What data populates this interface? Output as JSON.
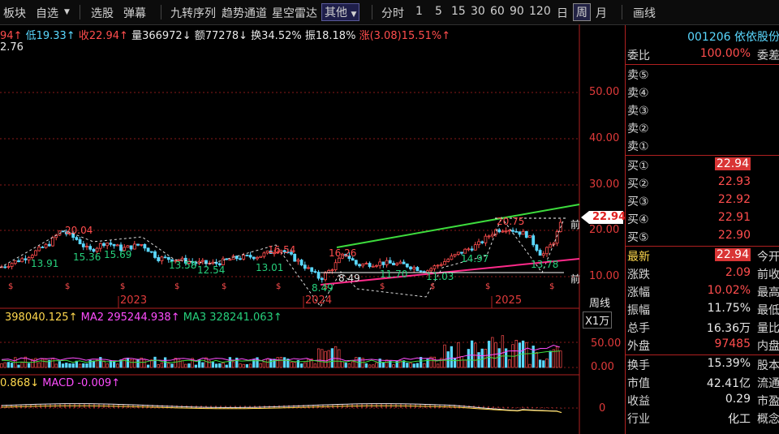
{
  "toolbar": {
    "items": [
      "板块",
      "自选",
      "选股",
      "弹幕",
      "九转序列",
      "趋势通道",
      "星空雷达",
      "其他",
      "分时",
      "1",
      "5",
      "15",
      "30",
      "60",
      "90",
      "120",
      "日",
      "周",
      "月",
      "画线"
    ]
  },
  "info": {
    "open_frag": "94↑",
    "low": "低19.33↑",
    "close": "收22.94↑",
    "volume": "量366972↓",
    "amount": "额77278↓",
    "turnover": "换34.52%",
    "amplitude": "振18.18%",
    "change": "涨(3.08)15.51%↑",
    "second": "2.76"
  },
  "price_axis": [
    "50.00",
    "40.00",
    "30.00",
    "20.00",
    "10.00"
  ],
  "current_price": "22.94",
  "current_tag": "前",
  "bottom_tag": "前",
  "years": [
    "2023",
    "2024",
    "2025"
  ],
  "period_label": "周线",
  "price_labels": {
    "high_left": "20.04",
    "l1": "13.91",
    "l2": "15.36",
    "l3": "15.69",
    "l4": "13.58",
    "l5": "12.54",
    "l6": "13.01",
    "l7": "16.54",
    "l8": "8.49",
    "l9": "8.49",
    "l10": "11.70",
    "l11": "11.03",
    "l12": "16.26",
    "l13": "14.97",
    "l14": "13.78",
    "l15": "20.75"
  },
  "volume_line": {
    "v1": "398040.125↑",
    "ma2": "MA2 295244.938↑",
    "ma3": "MA3 328241.063↑"
  },
  "volume_axis": [
    "50.00",
    "0.00"
  ],
  "volume_unit": "X1万",
  "macd_line": {
    "v1": "0.868↓",
    "macd": "MACD -0.009↑"
  },
  "macd_axis": "0",
  "panel": {
    "code_name": "001206 依依股份",
    "weibi": {
      "label": "委比",
      "value": "100.00%",
      "extra": "委差"
    },
    "sell": [
      "卖⑤",
      "卖④",
      "卖③",
      "卖②",
      "卖①"
    ],
    "buy": [
      {
        "label": "买①",
        "value": "22.94"
      },
      {
        "label": "买②",
        "value": "22.93"
      },
      {
        "label": "买③",
        "value": "22.92"
      },
      {
        "label": "买④",
        "value": "22.91"
      },
      {
        "label": "买⑤",
        "value": "22.90"
      }
    ],
    "stats": [
      {
        "label": "最新",
        "value": "22.94",
        "extra": "今开"
      },
      {
        "label": "涨跌",
        "value": "2.09",
        "extra": "前收"
      },
      {
        "label": "涨幅",
        "value": "10.02%",
        "extra": "最高"
      },
      {
        "label": "振幅",
        "value": "11.75%",
        "extra": "最低"
      },
      {
        "label": "总手",
        "value": "16.36万",
        "extra": "量比"
      },
      {
        "label": "外盘",
        "value": "97485",
        "extra": "内盘"
      }
    ],
    "stats2": [
      {
        "label": "换手",
        "value": "15.39%",
        "extra": "股本"
      },
      {
        "label": "市值",
        "value": "42.41亿",
        "extra": "流通"
      },
      {
        "label": "收益",
        "value": "0.29",
        "extra": "市盈"
      },
      {
        "label": "行业",
        "value": "化工",
        "extra": "概念"
      }
    ]
  },
  "colors": {
    "up": "#ff4d4d",
    "down": "#5ad8ff",
    "grid": "#8a1a1a",
    "upper_channel": "#3ddc3d",
    "lower_channel": "#ff2a8a"
  }
}
